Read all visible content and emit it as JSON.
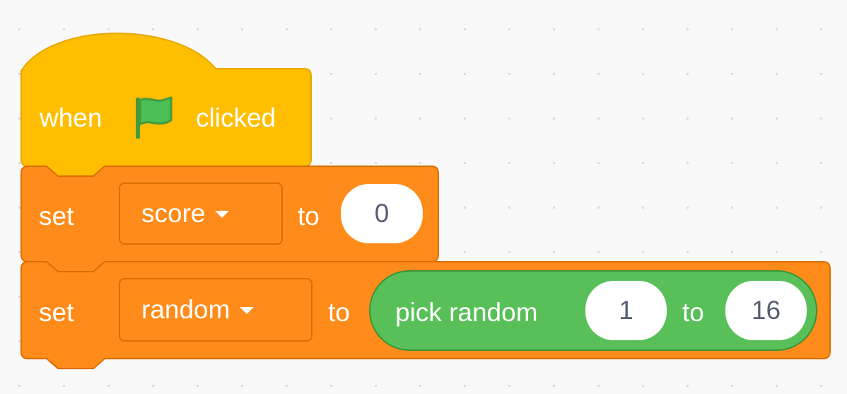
{
  "colors": {
    "events": "#ffbf00",
    "events_border": "#e6a600",
    "variables": "#ff8c1a",
    "variables_border": "#db6e00",
    "operators": "#59c059",
    "operators_border": "#389438",
    "flag": "#4cbf56",
    "input_text": "#575e75",
    "canvas": "#f9f9f9"
  },
  "hat_block": {
    "when_label": "when",
    "flag_icon": "green-flag-icon",
    "clicked_label": "clicked"
  },
  "set_score_block": {
    "set_label": "set",
    "variable": "score",
    "to_label": "to",
    "value": "0"
  },
  "set_random_block": {
    "set_label": "set",
    "variable": "random",
    "to_label": "to",
    "pick_random": {
      "label": "pick random",
      "from": "1",
      "to_label": "to",
      "to": "16"
    }
  }
}
